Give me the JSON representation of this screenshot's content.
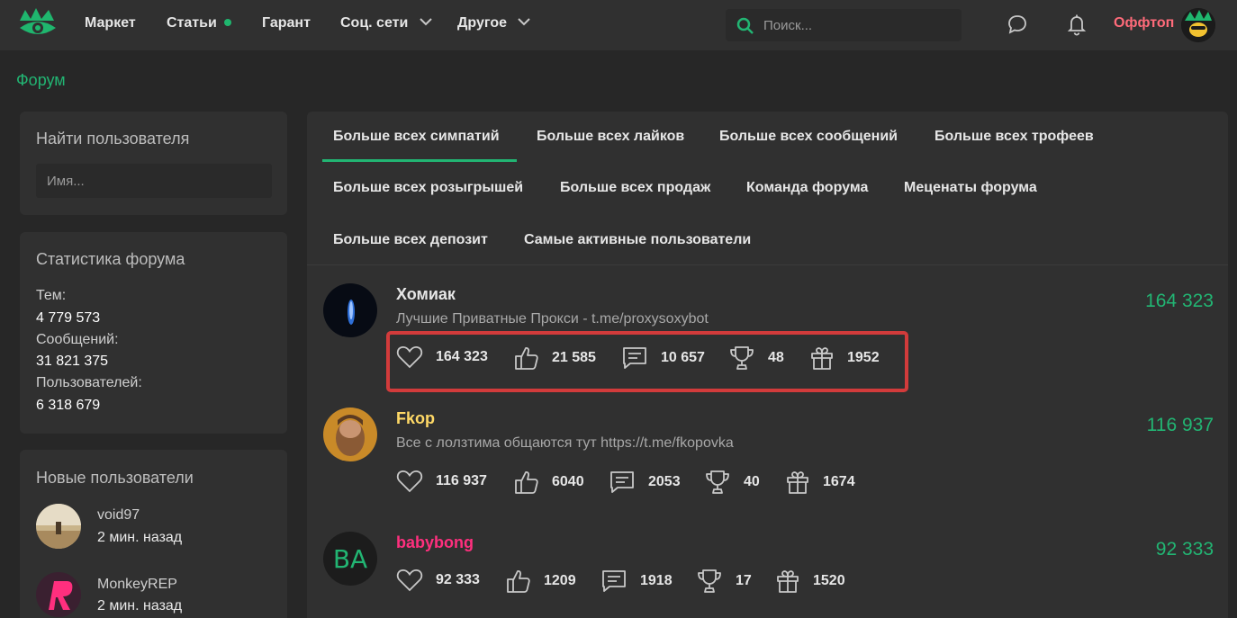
{
  "nav": {
    "items": [
      "Маркет",
      "Статьи",
      "Гарант",
      "Соц. сети",
      "Другое"
    ],
    "search_placeholder": "Поиск...",
    "offtop": "Оффтоп"
  },
  "breadcrumb": "Форум",
  "find_user": {
    "title": "Найти пользователя",
    "placeholder": "Имя..."
  },
  "stats": {
    "title": "Статистика форума",
    "items": [
      {
        "label": "Тем:",
        "value": "4 779 573"
      },
      {
        "label": "Сообщений:",
        "value": "31 821 375"
      },
      {
        "label": "Пользователей:",
        "value": "6 318 679"
      }
    ]
  },
  "new_users": {
    "title": "Новые пользователи",
    "users": [
      {
        "name": "void97",
        "time": "2 мин. назад"
      },
      {
        "name": "MonkeyREP",
        "time": "2 мин. назад"
      }
    ]
  },
  "tabs": [
    "Больше всех симпатий",
    "Больше всех лайков",
    "Больше всех сообщений",
    "Больше всех трофеев",
    "Больше всех розыгрышей",
    "Больше всех продаж",
    "Команда форума",
    "Меценаты форума",
    "Больше всех депозит",
    "Самые активные пользователи"
  ],
  "members": [
    {
      "name": "Хомиак",
      "name_color": "#e6e6e6",
      "subtitle": "Лучшие Приватные Прокси - t.me/proxysoxybot",
      "score": "164 323",
      "sympathies": "164 323",
      "likes": "21 585",
      "messages": "10 657",
      "trophies": "48",
      "gifts": "1952"
    },
    {
      "name": "Fkop",
      "name_color": "#ffd966",
      "subtitle": "Все с лолзтима общаются тут https://t.me/fkopovka",
      "score": "116 937",
      "sympathies": "116 937",
      "likes": "6040",
      "messages": "2053",
      "trophies": "40",
      "gifts": "1674"
    },
    {
      "name": "babybong",
      "name_color": "#ff2f7e",
      "avatar_initials": "BA",
      "subtitle": "",
      "score": "92 333",
      "sympathies": "92 333",
      "likes": "1209",
      "messages": "1918",
      "trophies": "17",
      "gifts": "1520"
    }
  ],
  "colors": {
    "accent": "#22b573",
    "highlight_box": "#d23b3b",
    "offtop": "#ff6b7a"
  },
  "icons": [
    "logo-icon",
    "search-icon",
    "chat-bubble-icon",
    "bell-icon",
    "heart-icon",
    "thumbs-up-icon",
    "message-icon",
    "trophy-icon",
    "gift-icon",
    "chevron-down-icon"
  ]
}
